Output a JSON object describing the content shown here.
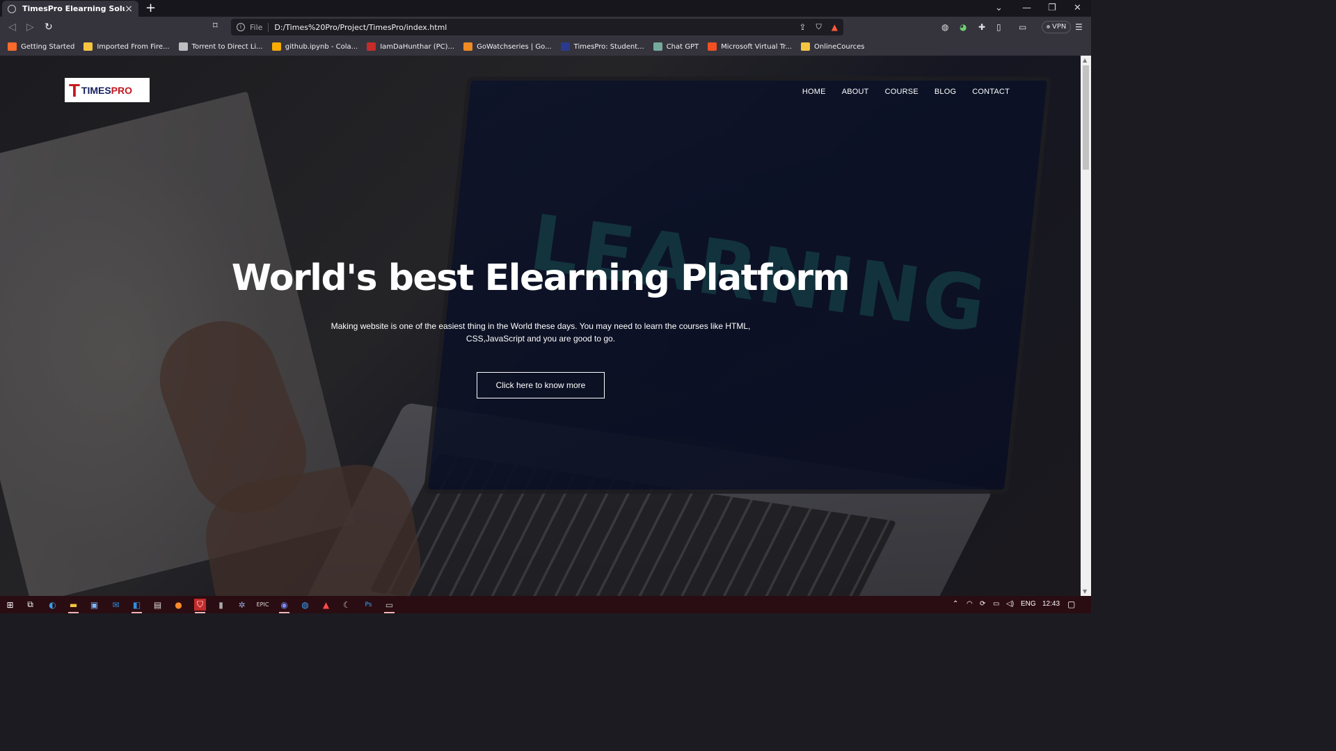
{
  "browser": {
    "tab_title": "TimesPro Elearning Solutions",
    "url_scheme": "File",
    "url": "D:/Times%20Pro/Project/TimesPro/index.html",
    "vpn_label": "VPN",
    "bookmarks": [
      {
        "label": "Getting Started",
        "icon": "firefox-icon",
        "color": "#ff6a2b"
      },
      {
        "label": "Imported From Fire...",
        "icon": "folder-icon",
        "color": "#f5c542"
      },
      {
        "label": "Torrent to Direct Li...",
        "icon": "globe-icon",
        "color": "#bdbdc2"
      },
      {
        "label": "github.ipynb - Cola...",
        "icon": "colab-icon",
        "color": "#f9ab00"
      },
      {
        "label": "IamDaHunthar (PC)...",
        "icon": "game-icon",
        "color": "#c42b2b"
      },
      {
        "label": "GoWatchseries | Go...",
        "icon": "gowatch-icon",
        "color": "#f08a24"
      },
      {
        "label": "TimesPro: Student...",
        "icon": "timespro-icon",
        "color": "#2b3a8f"
      },
      {
        "label": "Chat GPT",
        "icon": "chatgpt-icon",
        "color": "#74aa9c"
      },
      {
        "label": "Microsoft Virtual Tr...",
        "icon": "microsoft-icon",
        "color": "#f25022"
      },
      {
        "label": "OnlineCources",
        "icon": "folder-icon",
        "color": "#f5c542"
      }
    ]
  },
  "page": {
    "logo_mark": "T",
    "logo_text_1": "TIMES",
    "logo_text_2": "PRO",
    "nav": [
      "HOME",
      "ABOUT",
      "COURSE",
      "BLOG",
      "CONTACT"
    ],
    "hero_title": "World's best Elearning Platform",
    "hero_subtitle": "Making website is one of the easiest thing in the World these days. You may need to learn the courses like HTML, CSS,JavaScript and you are good to go.",
    "cta_label": "Click here to know more",
    "background_word": "LEARNING"
  },
  "taskbar": {
    "language": "ENG",
    "time": "12:43"
  },
  "colors": {
    "accent_red": "#c4161c",
    "brand_navy": "#14205e",
    "taskbar_bg": "#2a0d12"
  }
}
